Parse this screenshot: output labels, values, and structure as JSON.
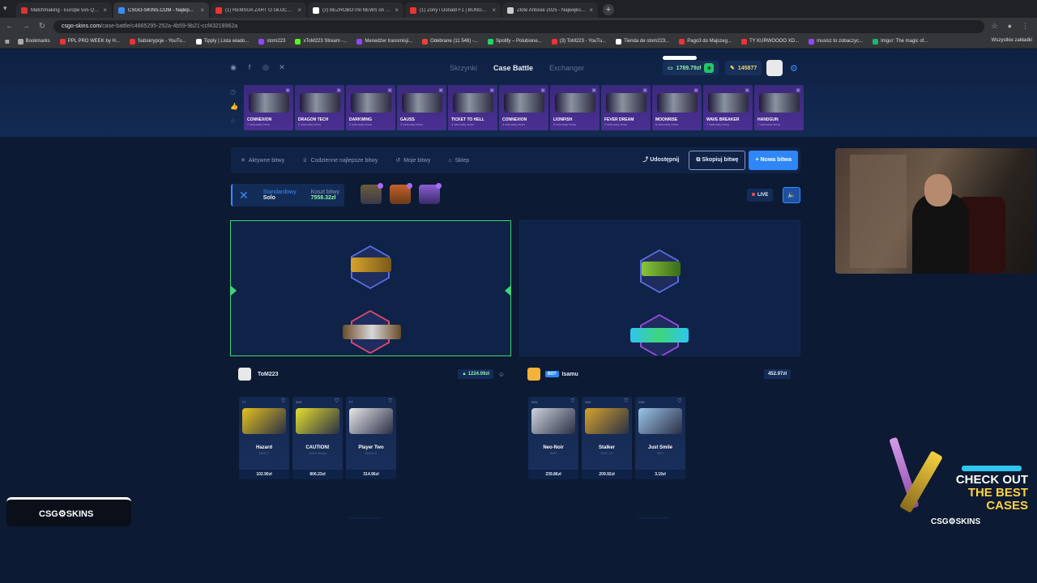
{
  "browser": {
    "tabs": [
      {
        "title": "Matchmaking - Europe 5v5 Qu...",
        "color": "#d33"
      },
      {
        "title": "CSGO-SKINS.COM - Najlep...",
        "color": "#3a8cff",
        "active": true
      },
      {
        "title": "(1) REMSUA ŻART O GŁUCHYM...",
        "color": "#e33"
      },
      {
        "title": "(2) BEZROBOTNI NEWS on X: \"...",
        "color": "#fff"
      },
      {
        "title": "(1) Żony i Donald F1 | BUNGE...",
        "color": "#e33"
      },
      {
        "title": "Złote Antosie 2025 - Największ...",
        "color": "#ccc"
      }
    ],
    "url_main": "csgo-skins.com",
    "url_path": "/case-battle/c4865295-252a-4b59-9b21-ccf43218962a",
    "bookmarks": [
      {
        "label": "Bookmarks",
        "color": "#aaa"
      },
      {
        "label": "PPL PRO WEEK by H...",
        "color": "#e33"
      },
      {
        "label": "Subskrypcje - YouTu...",
        "color": "#e33"
      },
      {
        "label": "Tipply | Lista wiado...",
        "color": "#fff"
      },
      {
        "label": "stom223",
        "color": "#9147ff"
      },
      {
        "label": "xToM223 Stream -...",
        "color": "#53fc18"
      },
      {
        "label": "Menedżer transmisji...",
        "color": "#9147ff"
      },
      {
        "label": "Odebrane (11 548) -...",
        "color": "#ea4335"
      },
      {
        "label": "Spotify – Polubione...",
        "color": "#1ed760"
      },
      {
        "label": "(3) ToM223 - YouTu...",
        "color": "#e33"
      },
      {
        "label": "Tienda de stom223...",
        "color": "#fff"
      },
      {
        "label": "Pago3 do Majszeg...",
        "color": "#e33"
      },
      {
        "label": "TY KURWOOOO XD...",
        "color": "#e33"
      },
      {
        "label": "musisz to zobaczyc...",
        "color": "#9147ff"
      },
      {
        "label": "Imgur: The magic of...",
        "color": "#1bb76e"
      }
    ],
    "bookmarks_right": "Wszystkie zakładki"
  },
  "site": {
    "nav": [
      "Skrzynki",
      "Case Battle",
      "Exchanger"
    ],
    "balance": "1789.79zł",
    "points": "145877",
    "cases_strip": [
      {
        "name": "CONNEXION",
        "sub": "2 sekundy temu"
      },
      {
        "name": "DRAGON TECH",
        "sub": "2 sekundy temu"
      },
      {
        "name": "DARKWING",
        "sub": "2 sekundy temu"
      },
      {
        "name": "GAUSS",
        "sub": "2 sekundy temu"
      },
      {
        "name": "TICKET TO HELL",
        "sub": "3 sekundy temu"
      },
      {
        "name": "CONNEXION",
        "sub": "4 sekundy temu"
      },
      {
        "name": "LIONFISH",
        "sub": "5 sekundy temu"
      },
      {
        "name": "FEVER DREAM",
        "sub": "5 sekundy temu"
      },
      {
        "name": "MOONRISE",
        "sub": "6 sekundy temu"
      },
      {
        "name": "WAVE BREAKER",
        "sub": "7 sekundy temu"
      },
      {
        "name": "HANDGUN",
        "sub": "7 sekundy temu"
      }
    ],
    "toolbar": {
      "active": "Aktywne bitwy",
      "daily": "Codzienne najlepsze bitwy",
      "mine": "Moje bitwy",
      "shop": "Sklep",
      "share": "Udostępnij",
      "copy": "Skopiuj bitwę",
      "new": "Nowa bitwa"
    },
    "mode": {
      "label": "Standardowy",
      "value": "Solo"
    },
    "cost": {
      "label": "Koszt bitwy",
      "value": "7558.32zł"
    },
    "live": "LIVE",
    "players": [
      {
        "name": "ToM223",
        "total": "1224.09zł",
        "items": [
          {
            "cond": "FT",
            "name": "Hazard",
            "type": "MAG-7",
            "price": "102.90zł",
            "color": "#e6c21e"
          },
          {
            "cond": "WW",
            "name": "CAUTION!",
            "type": "Hand Wraps",
            "price": "806.23zł",
            "color": "#e6e02e"
          },
          {
            "cond": "FT",
            "name": "Player Two",
            "type": "M4A1-S",
            "price": "314.96zł",
            "color": "#e7e7ea"
          }
        ],
        "seed": "Client seed: 1f24a9f4"
      },
      {
        "name": "Isamu",
        "bot": "BOT",
        "total": "452.97zł",
        "items": [
          {
            "cond": "WW",
            "name": "Neo-Noir",
            "type": "AWP",
            "price": "239.86zł",
            "color": "#cfd3dc"
          },
          {
            "cond": "WW",
            "name": "Stalker",
            "type": "MAC-10",
            "price": "209.92zł",
            "color": "#d6a42c"
          },
          {
            "cond": "WW",
            "name": "Just Smile",
            "type": "MP7",
            "price": "3.19zł",
            "color": "#9bc4e8"
          }
        ],
        "seed": "Client seed: 2f52a6f4"
      }
    ],
    "promo": {
      "line1": "CHECK OUT",
      "line2": "THE BEST",
      "line3": "CASES",
      "logo": "CSG⚙SKINS"
    },
    "brand": "CSG⚙SKINS"
  }
}
